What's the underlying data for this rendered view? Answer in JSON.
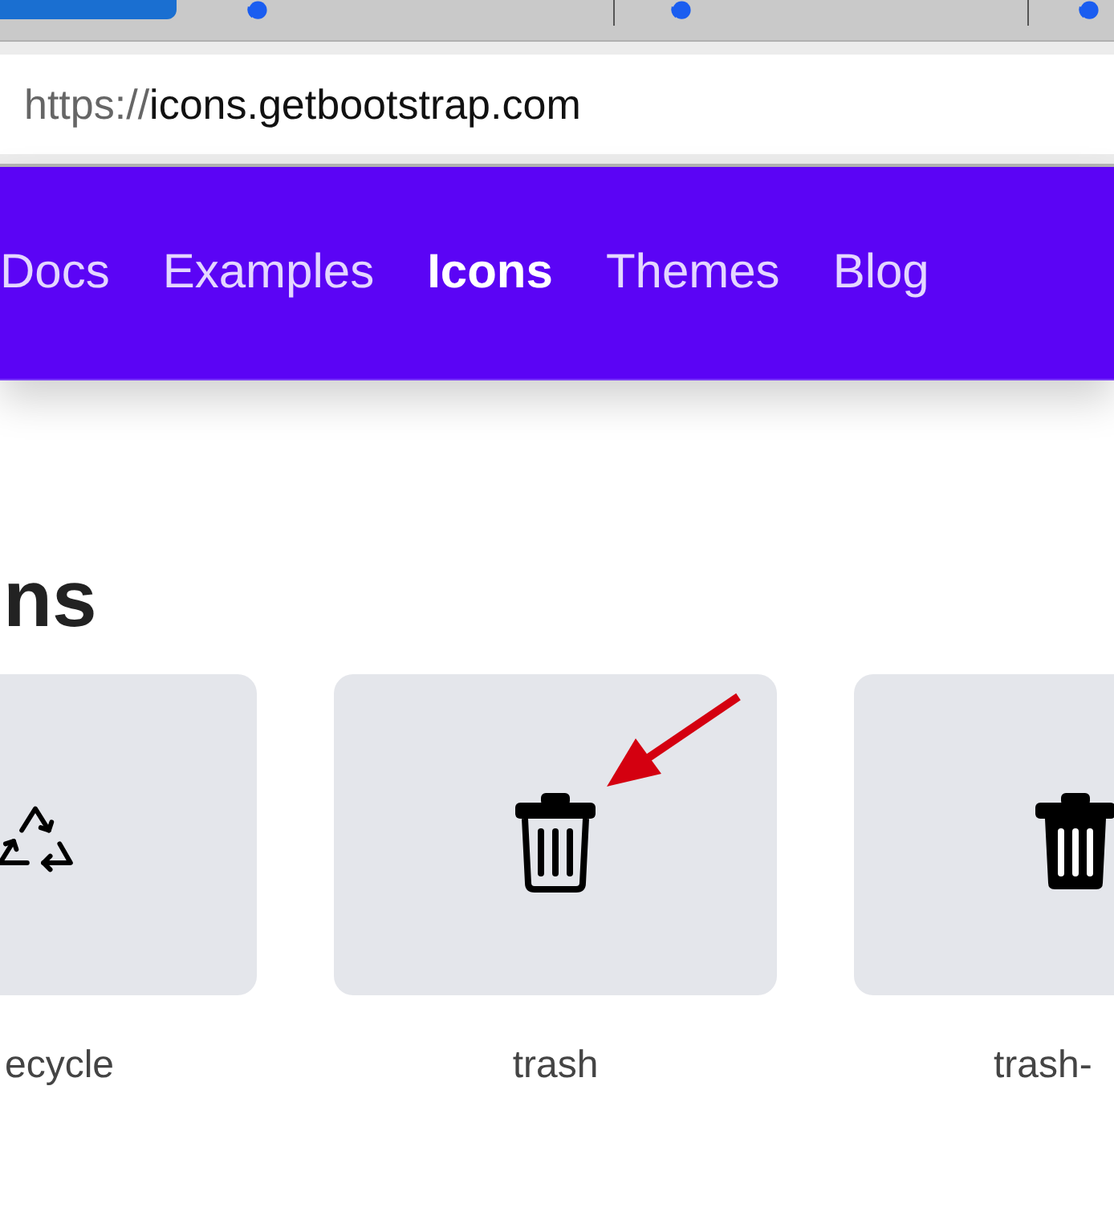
{
  "address_bar": {
    "scheme": "https://",
    "host": "icons.getbootstrap.com"
  },
  "nav": [
    {
      "label": "Docs",
      "selected": false
    },
    {
      "label": "Examples",
      "selected": false
    },
    {
      "label": "Icons",
      "selected": true
    },
    {
      "label": "Themes",
      "selected": false
    },
    {
      "label": "Blog",
      "selected": false
    }
  ],
  "heading": "ns",
  "icons": [
    {
      "kind": "recycle",
      "label": "ecycle"
    },
    {
      "kind": "trash",
      "label": "trash",
      "annotated": true
    },
    {
      "kind": "trash-fill",
      "label": "trash-"
    }
  ]
}
